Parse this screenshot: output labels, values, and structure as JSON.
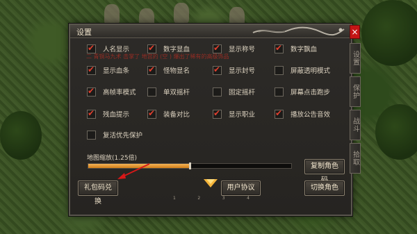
{
  "window": {
    "title": "设置",
    "close_label": "×"
  },
  "side_tabs": [
    {
      "label": "设置",
      "active": true
    },
    {
      "label": "保护",
      "active": false
    },
    {
      "label": "战斗",
      "active": false
    },
    {
      "label": "拾取",
      "active": false
    }
  ],
  "overlay_text": "二 青铜马九术 击掌了 地宫的 (空 ) 爆出了稀有的高级饰品",
  "options": [
    {
      "label": "人名显示",
      "checked": true
    },
    {
      "label": "数字显血",
      "checked": true
    },
    {
      "label": "显示称号",
      "checked": true
    },
    {
      "label": "数字飘血",
      "checked": true
    },
    {
      "label": "显示血条",
      "checked": true
    },
    {
      "label": "怪物显名",
      "checked": true
    },
    {
      "label": "显示封号",
      "checked": true
    },
    {
      "label": "屏蔽透明模式",
      "checked": false
    },
    {
      "label": "高帧率模式",
      "checked": true
    },
    {
      "label": "单双摇杆",
      "checked": false
    },
    {
      "label": "固定摇杆",
      "checked": false
    },
    {
      "label": "屏幕点击跑步",
      "checked": false
    },
    {
      "label": "残血提示",
      "checked": true
    },
    {
      "label": "装备对比",
      "checked": true
    },
    {
      "label": "显示职业",
      "checked": true
    },
    {
      "label": "播放公告音效",
      "checked": true
    },
    {
      "label": "复活优先保护",
      "checked": false
    }
  ],
  "map_zoom": {
    "label": "地图缩放(1.25倍)",
    "fraction": 0.5
  },
  "buttons": {
    "copy_role_code": "复制角色码",
    "gift_code": "礼包码兑换",
    "user_agreement": "用户协议",
    "switch_role": "切换角色"
  },
  "page_numbers": [
    "1",
    "2",
    "3",
    "4"
  ],
  "colors": {
    "check": "#e0402f",
    "slider": "#e8992f",
    "close": "#c41515",
    "arrow": "#d81818"
  },
  "icons": {
    "collapse": "triangle-down-icon",
    "decoration": "dragon-icon"
  }
}
